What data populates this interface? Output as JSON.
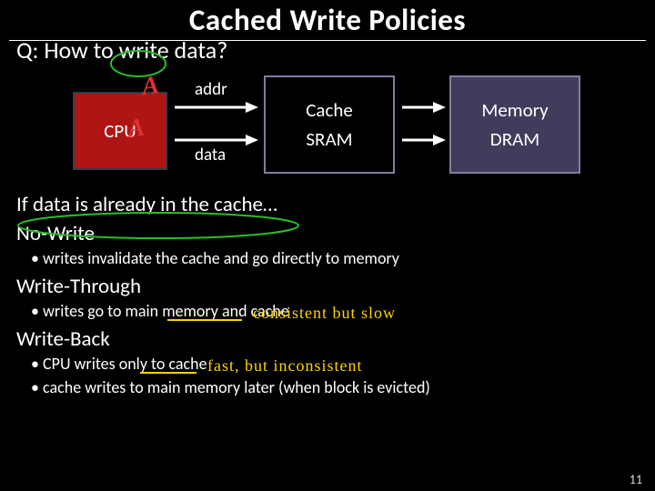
{
  "title": "Cached Write Policies",
  "question": "Q: How to write data?",
  "diagram": {
    "cpu": "CPU",
    "addr_label": "addr",
    "data_label": "data",
    "cache_top": "Cache",
    "cache_bot": "SRAM",
    "mem_top": "Memory",
    "mem_bot": "DRAM"
  },
  "body": {
    "cond": "If data is already in the cache…",
    "p1": "No-Write",
    "p1_b1": "writes invalidate the cache and go directly to memory",
    "p2": "Write-Through",
    "p2_b1": "writes go to main memory and cache",
    "p3": "Write-Back",
    "p3_b1": "CPU writes only to cache",
    "p3_b2": "cache writes to main memory later (when block is evicted)"
  },
  "annotations": {
    "wt": "consistent   but  slow",
    "wb": "fast,  but  inconsistent",
    "marks": "A"
  },
  "page_number": "11"
}
